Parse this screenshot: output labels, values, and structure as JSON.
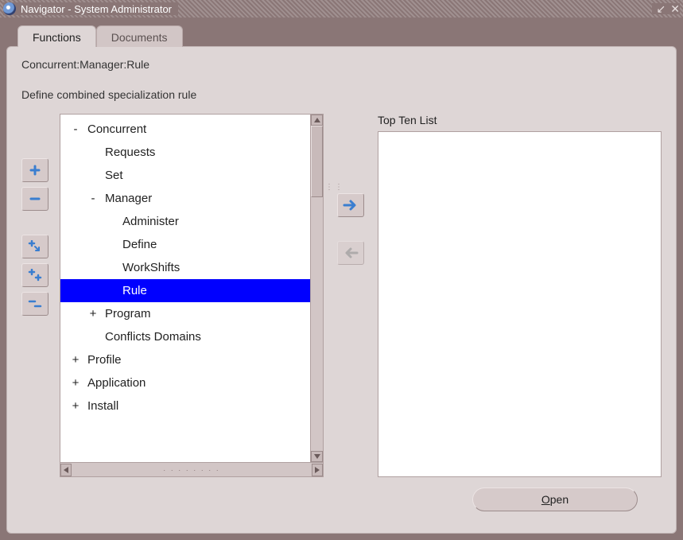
{
  "window": {
    "title": "Navigator - System Administrator"
  },
  "tabs": [
    {
      "label": "Functions",
      "active": true
    },
    {
      "label": "Documents",
      "active": false
    }
  ],
  "breadcrumb": "Concurrent:Manager:Rule",
  "description": "Define combined specialization rule",
  "tree": [
    {
      "marker": "-",
      "label": "Concurrent",
      "indent": 0,
      "selected": false
    },
    {
      "marker": "",
      "label": "Requests",
      "indent": 1,
      "selected": false
    },
    {
      "marker": "",
      "label": "Set",
      "indent": 1,
      "selected": false
    },
    {
      "marker": "-",
      "label": "Manager",
      "indent": 1,
      "selected": false
    },
    {
      "marker": "",
      "label": "Administer",
      "indent": 2,
      "selected": false
    },
    {
      "marker": "",
      "label": "Define",
      "indent": 2,
      "selected": false
    },
    {
      "marker": "",
      "label": "WorkShifts",
      "indent": 2,
      "selected": false
    },
    {
      "marker": "",
      "label": "Rule",
      "indent": 2,
      "selected": true
    },
    {
      "marker": "+",
      "label": "Program",
      "indent": 1,
      "selected": false
    },
    {
      "marker": "",
      "label": "Conflicts Domains",
      "indent": 1,
      "selected": false
    },
    {
      "marker": "+",
      "label": "Profile",
      "indent": 0,
      "selected": false
    },
    {
      "marker": "+",
      "label": "Application",
      "indent": 0,
      "selected": false
    },
    {
      "marker": "+",
      "label": "Install",
      "indent": 0,
      "selected": false
    }
  ],
  "right": {
    "top_ten_label": "Top Ten List"
  },
  "buttons": {
    "open": "Open"
  },
  "icons": {
    "expand": "expand-icon",
    "collapse": "collapse-icon",
    "expand_branch": "expand-branch-icon",
    "expand_all": "expand-all-icon",
    "collapse_all": "collapse-all-icon",
    "move_right": "arrow-right-icon",
    "move_left": "arrow-left-icon",
    "minimize": "minimize-icon",
    "close": "close-icon"
  }
}
